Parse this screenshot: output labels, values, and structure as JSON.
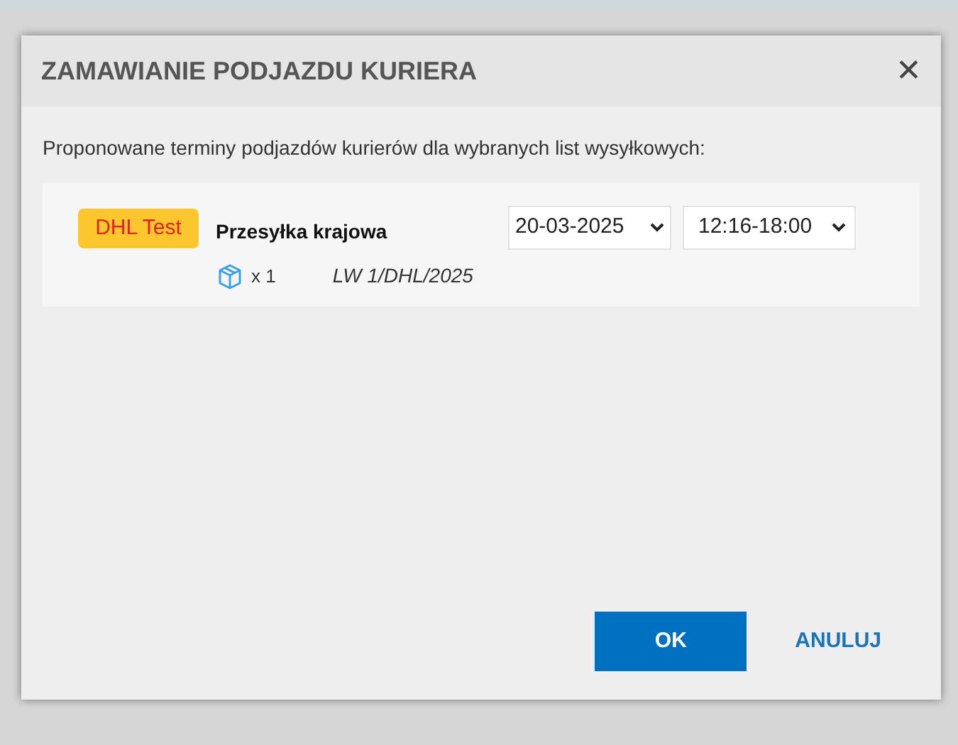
{
  "dialog": {
    "title": "ZAMAWIANIE PODJAZDU KURIERA",
    "close": "✕",
    "intro": "Proponowane terminy podjazdów kurierów dla wybranych list wysyłkowych:",
    "shipments": [
      {
        "carrier": "DHL Test",
        "service": "Przesyłka krajowa",
        "date": "20-03-2025",
        "time": "12:16-18:00",
        "packages": "x 1",
        "list": "LW 1/DHL/2025"
      }
    ],
    "buttons": [
      {
        "label": "OK",
        "kind": "primary"
      },
      {
        "label": "ANULUJ",
        "kind": "link"
      }
    ]
  }
}
